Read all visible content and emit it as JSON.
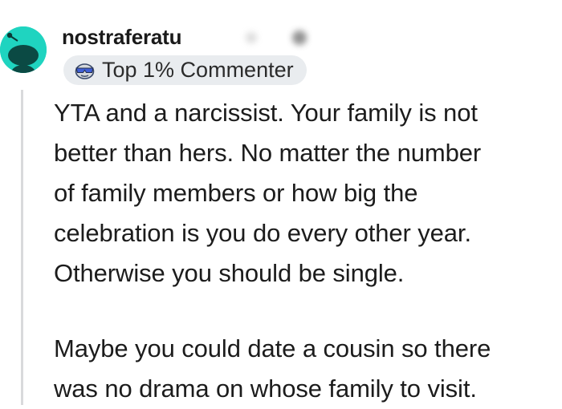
{
  "comment": {
    "author": "nostraferatu",
    "avatar_icon": "reddit-snoo-icon",
    "avatar_color": "#1fd4c0",
    "flair": {
      "icon": "sunglasses-emoji-icon",
      "text": "Top 1% Commenter"
    },
    "paragraphs": [
      {
        "lines": [
          "YTA and a narcissist. Your family is not",
          "better than hers. No matter the number",
          "of family members or how big the",
          "celebration is you do every other year.",
          "Otherwise you should be single."
        ]
      },
      {
        "lines": [
          "Maybe you could date a cousin so there",
          "was no drama on whose family to visit."
        ]
      }
    ]
  }
}
